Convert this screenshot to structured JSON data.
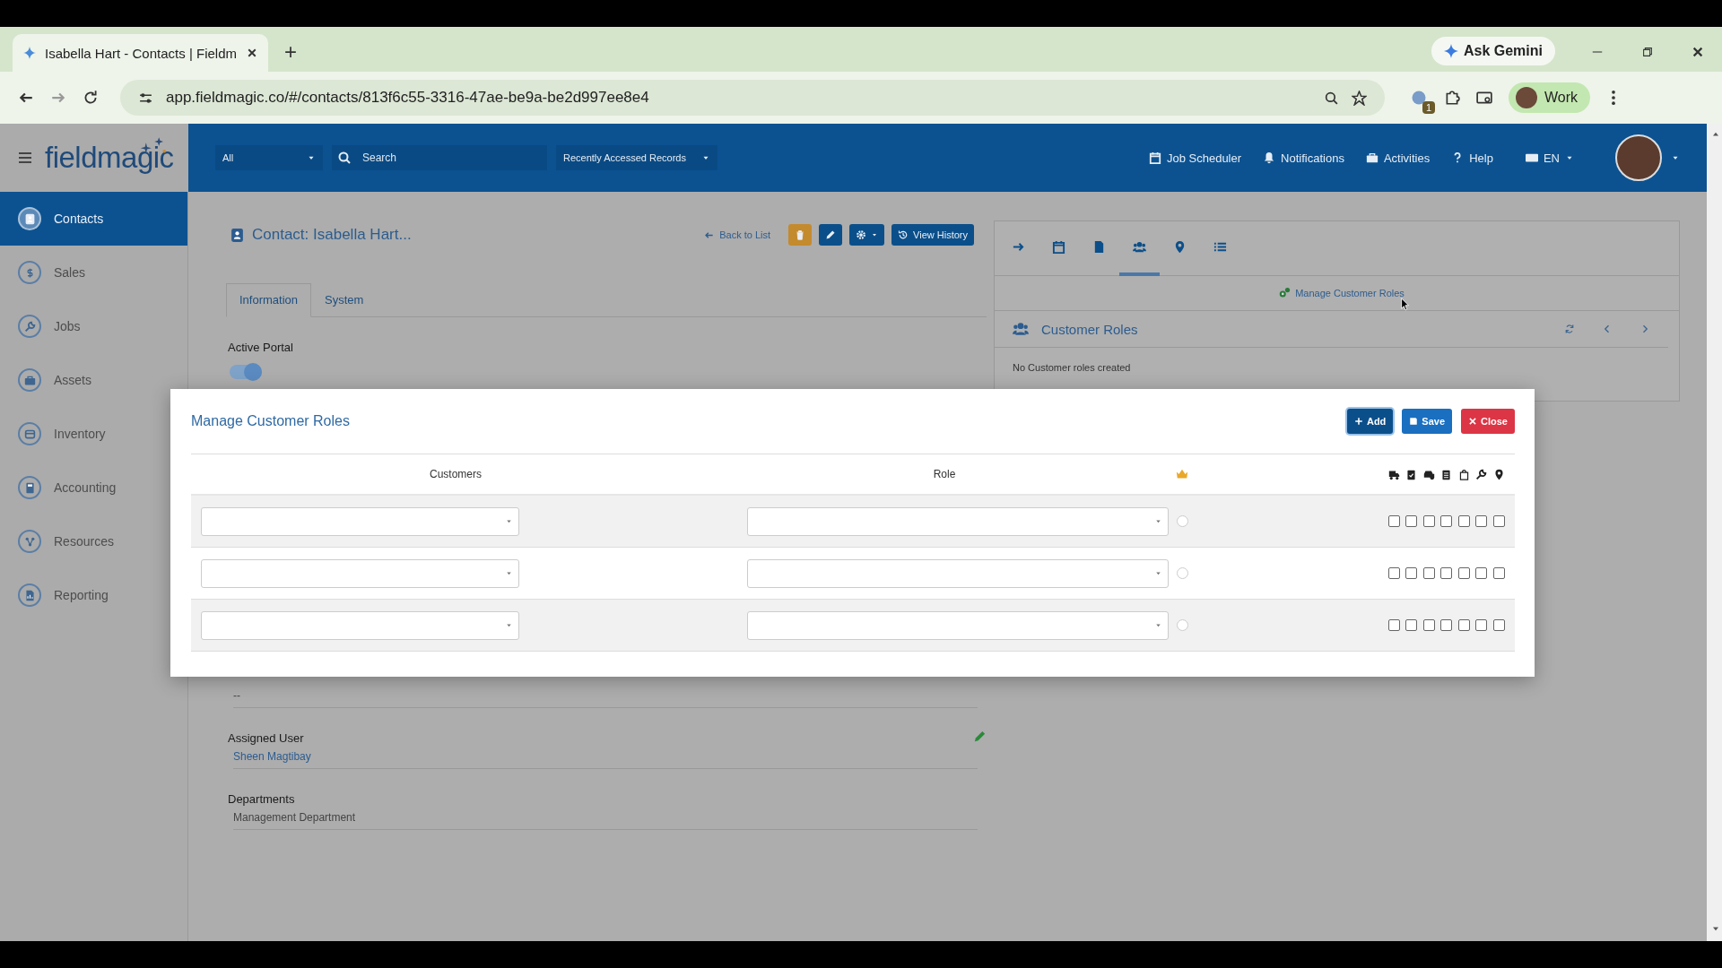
{
  "browser": {
    "tab_title": "Isabella Hart - Contacts | Fieldm",
    "new_tab": "+",
    "ask_gemini": "Ask Gemini",
    "url": "app.fieldmagic.co/#/contacts/813f6c55-3316-47ae-be9a-be2d997ee8e4",
    "extension_badge": "1",
    "profile": "Work"
  },
  "header": {
    "logo": "fieldmagic",
    "filter": "All",
    "search": {
      "placeholder": "Search"
    },
    "recent": "Recently Accessed Records",
    "nav": [
      "Job Scheduler",
      "Notifications",
      "Activities",
      "Help"
    ],
    "language": "EN"
  },
  "sidebar": {
    "items": [
      {
        "label": "Contacts",
        "selected": true
      },
      {
        "label": "Sales",
        "selected": false
      },
      {
        "label": "Jobs",
        "selected": false
      },
      {
        "label": "Assets",
        "selected": false
      },
      {
        "label": "Inventory",
        "selected": false
      },
      {
        "label": "Accounting",
        "selected": false
      },
      {
        "label": "Resources",
        "selected": false
      },
      {
        "label": "Reporting",
        "selected": false
      }
    ]
  },
  "contact": {
    "title": "Contact: Isabella Hart...",
    "back": "Back to List",
    "view_history": "View History",
    "tabs": [
      {
        "label": "Information",
        "selected": true
      },
      {
        "label": "System",
        "selected": false
      }
    ],
    "active_portal": {
      "label": "Active Portal",
      "on": true
    },
    "blank_value": "--",
    "assigned_user": {
      "label": "Assigned User",
      "value": "Sheen Magtibay"
    },
    "departments": {
      "label": "Departments",
      "value": "Management Department"
    }
  },
  "side_panel": {
    "icon_tabs": [
      {
        "selected": false
      },
      {
        "selected": false
      },
      {
        "selected": false
      },
      {
        "selected": true
      },
      {
        "selected": false
      },
      {
        "selected": false
      }
    ],
    "manage_link": "Manage Customer Roles",
    "section_title": "Customer Roles",
    "empty_text": "No Customer roles created"
  },
  "modal": {
    "title": "Manage Customer Roles",
    "buttons": [
      "Add",
      "Save",
      "Close"
    ],
    "columns": [
      "Customers",
      "Role"
    ],
    "rows": [
      {
        "primary": false,
        "checks": [
          false,
          false,
          false,
          false,
          false,
          false,
          false
        ]
      },
      {
        "primary": false,
        "checks": [
          false,
          false,
          false,
          false,
          false,
          false,
          false
        ]
      },
      {
        "primary": false,
        "checks": [
          false,
          false,
          false,
          false,
          false,
          false,
          false
        ]
      }
    ]
  }
}
